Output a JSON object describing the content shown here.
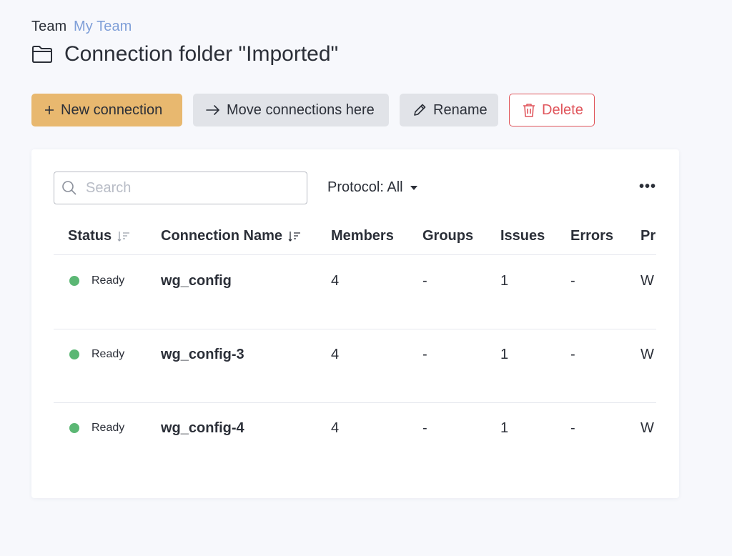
{
  "breadcrumb": {
    "label": "Team",
    "link": "My Team"
  },
  "page_title": "Connection folder \"Imported\"",
  "toolbar": {
    "new_connection": "New connection",
    "move_connections": "Move connections here",
    "rename": "Rename",
    "delete": "Delete"
  },
  "colors": {
    "primary": "#e8b86f",
    "link": "#7f9fd8",
    "danger": "#e0555b",
    "status_ready": "#5bb774"
  },
  "search": {
    "placeholder": "Search",
    "value": ""
  },
  "filter": {
    "protocol": "Protocol: All"
  },
  "more_menu": "•••",
  "table": {
    "columns": [
      "Status",
      "Connection Name",
      "Members",
      "Groups",
      "Issues",
      "Errors",
      "Pro"
    ],
    "rows": [
      {
        "status": "Ready",
        "name": "wg_config",
        "members": "4",
        "groups": "-",
        "issues": "1",
        "errors": "-",
        "protocol": "W"
      },
      {
        "status": "Ready",
        "name": "wg_config-3",
        "members": "4",
        "groups": "-",
        "issues": "1",
        "errors": "-",
        "protocol": "W"
      },
      {
        "status": "Ready",
        "name": "wg_config-4",
        "members": "4",
        "groups": "-",
        "issues": "1",
        "errors": "-",
        "protocol": "W"
      }
    ]
  }
}
